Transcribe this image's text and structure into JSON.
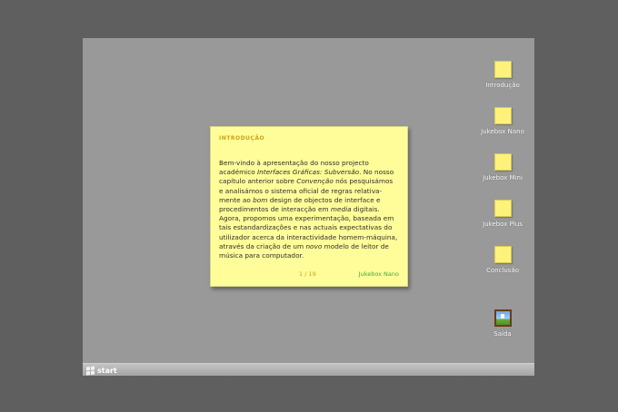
{
  "taskbar": {
    "start_label": "start"
  },
  "note": {
    "title": "INTRODUÇÃO",
    "body": [
      [
        {
          "t": "Bem-vindo à apresentação do nosso projecto"
        }
      ],
      [
        {
          "t": "académico "
        },
        {
          "t": "Interfaces Gráficas: Subversão",
          "i": true
        },
        {
          "t": ". No nosso"
        }
      ],
      [
        {
          "t": "capítulo anterior sobre "
        },
        {
          "t": "Convenção",
          "i": true
        },
        {
          "t": " nós pesquisámos"
        }
      ],
      [
        {
          "t": "e analisámos o sistema oficial de regras relativa-"
        }
      ],
      [
        {
          "t": "mente ao "
        },
        {
          "t": "bom",
          "i": true
        },
        {
          "t": " design de objectos de interface e"
        }
      ],
      [
        {
          "t": "procedimentos de interacção em "
        },
        {
          "t": "media",
          "i": true
        },
        {
          "t": " digitais."
        }
      ],
      [
        {
          "t": "Agora, propomos uma experimentação, baseada em"
        }
      ],
      [
        {
          "t": "tais estandardizações e nas actuais expectativas do"
        }
      ],
      [
        {
          "t": "utilizador acerca da interactividade homem-máquina,"
        }
      ],
      [
        {
          "t": "através da criação de um "
        },
        {
          "t": "novo",
          "i": true
        },
        {
          "t": " modelo de leitor de"
        }
      ],
      [
        {
          "t": "música para computador."
        }
      ]
    ],
    "page": "1 / 19",
    "next_link": "Jukebox Nano"
  },
  "desktop_icons": [
    {
      "label": "Introdução",
      "icon": "sticky-note-icon"
    },
    {
      "label": "Jukebox Nano",
      "icon": "sticky-note-icon"
    },
    {
      "label": "Jukebox Mini",
      "icon": "sticky-note-icon"
    },
    {
      "label": "Jukebox Plus",
      "icon": "sticky-note-icon"
    },
    {
      "label": "Conclusão",
      "icon": "sticky-note-icon"
    },
    {
      "label": "Saída",
      "icon": "exit-picture-icon"
    }
  ],
  "colors": {
    "note_bg": "#fffd99",
    "accent_gold": "#c8a415",
    "link_green": "#41a83a",
    "desktop": "#999999"
  }
}
